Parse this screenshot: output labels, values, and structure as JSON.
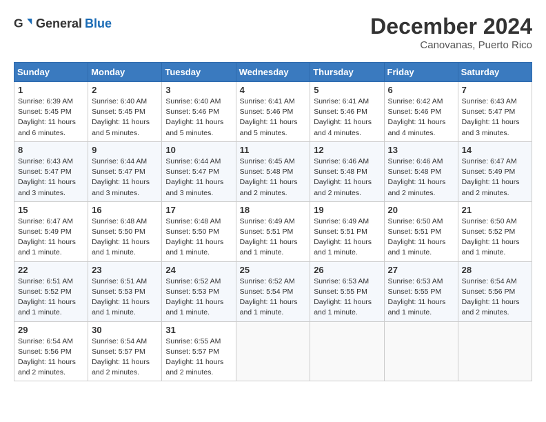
{
  "header": {
    "logo_general": "General",
    "logo_blue": "Blue",
    "month_year": "December 2024",
    "location": "Canovanas, Puerto Rico"
  },
  "weekdays": [
    "Sunday",
    "Monday",
    "Tuesday",
    "Wednesday",
    "Thursday",
    "Friday",
    "Saturday"
  ],
  "weeks": [
    [
      {
        "day": 1,
        "sunrise": "6:39 AM",
        "sunset": "5:45 PM",
        "daylight": "11 hours and 6 minutes."
      },
      {
        "day": 2,
        "sunrise": "6:40 AM",
        "sunset": "5:45 PM",
        "daylight": "11 hours and 5 minutes."
      },
      {
        "day": 3,
        "sunrise": "6:40 AM",
        "sunset": "5:46 PM",
        "daylight": "11 hours and 5 minutes."
      },
      {
        "day": 4,
        "sunrise": "6:41 AM",
        "sunset": "5:46 PM",
        "daylight": "11 hours and 5 minutes."
      },
      {
        "day": 5,
        "sunrise": "6:41 AM",
        "sunset": "5:46 PM",
        "daylight": "11 hours and 4 minutes."
      },
      {
        "day": 6,
        "sunrise": "6:42 AM",
        "sunset": "5:46 PM",
        "daylight": "11 hours and 4 minutes."
      },
      {
        "day": 7,
        "sunrise": "6:43 AM",
        "sunset": "5:47 PM",
        "daylight": "11 hours and 3 minutes."
      }
    ],
    [
      {
        "day": 8,
        "sunrise": "6:43 AM",
        "sunset": "5:47 PM",
        "daylight": "11 hours and 3 minutes."
      },
      {
        "day": 9,
        "sunrise": "6:44 AM",
        "sunset": "5:47 PM",
        "daylight": "11 hours and 3 minutes."
      },
      {
        "day": 10,
        "sunrise": "6:44 AM",
        "sunset": "5:47 PM",
        "daylight": "11 hours and 3 minutes."
      },
      {
        "day": 11,
        "sunrise": "6:45 AM",
        "sunset": "5:48 PM",
        "daylight": "11 hours and 2 minutes."
      },
      {
        "day": 12,
        "sunrise": "6:46 AM",
        "sunset": "5:48 PM",
        "daylight": "11 hours and 2 minutes."
      },
      {
        "day": 13,
        "sunrise": "6:46 AM",
        "sunset": "5:48 PM",
        "daylight": "11 hours and 2 minutes."
      },
      {
        "day": 14,
        "sunrise": "6:47 AM",
        "sunset": "5:49 PM",
        "daylight": "11 hours and 2 minutes."
      }
    ],
    [
      {
        "day": 15,
        "sunrise": "6:47 AM",
        "sunset": "5:49 PM",
        "daylight": "11 hours and 1 minute."
      },
      {
        "day": 16,
        "sunrise": "6:48 AM",
        "sunset": "5:50 PM",
        "daylight": "11 hours and 1 minute."
      },
      {
        "day": 17,
        "sunrise": "6:48 AM",
        "sunset": "5:50 PM",
        "daylight": "11 hours and 1 minute."
      },
      {
        "day": 18,
        "sunrise": "6:49 AM",
        "sunset": "5:51 PM",
        "daylight": "11 hours and 1 minute."
      },
      {
        "day": 19,
        "sunrise": "6:49 AM",
        "sunset": "5:51 PM",
        "daylight": "11 hours and 1 minute."
      },
      {
        "day": 20,
        "sunrise": "6:50 AM",
        "sunset": "5:51 PM",
        "daylight": "11 hours and 1 minute."
      },
      {
        "day": 21,
        "sunrise": "6:50 AM",
        "sunset": "5:52 PM",
        "daylight": "11 hours and 1 minute."
      }
    ],
    [
      {
        "day": 22,
        "sunrise": "6:51 AM",
        "sunset": "5:52 PM",
        "daylight": "11 hours and 1 minute."
      },
      {
        "day": 23,
        "sunrise": "6:51 AM",
        "sunset": "5:53 PM",
        "daylight": "11 hours and 1 minute."
      },
      {
        "day": 24,
        "sunrise": "6:52 AM",
        "sunset": "5:53 PM",
        "daylight": "11 hours and 1 minute."
      },
      {
        "day": 25,
        "sunrise": "6:52 AM",
        "sunset": "5:54 PM",
        "daylight": "11 hours and 1 minute."
      },
      {
        "day": 26,
        "sunrise": "6:53 AM",
        "sunset": "5:55 PM",
        "daylight": "11 hours and 1 minute."
      },
      {
        "day": 27,
        "sunrise": "6:53 AM",
        "sunset": "5:55 PM",
        "daylight": "11 hours and 1 minute."
      },
      {
        "day": 28,
        "sunrise": "6:54 AM",
        "sunset": "5:56 PM",
        "daylight": "11 hours and 2 minutes."
      }
    ],
    [
      {
        "day": 29,
        "sunrise": "6:54 AM",
        "sunset": "5:56 PM",
        "daylight": "11 hours and 2 minutes."
      },
      {
        "day": 30,
        "sunrise": "6:54 AM",
        "sunset": "5:57 PM",
        "daylight": "11 hours and 2 minutes."
      },
      {
        "day": 31,
        "sunrise": "6:55 AM",
        "sunset": "5:57 PM",
        "daylight": "11 hours and 2 minutes."
      },
      null,
      null,
      null,
      null
    ]
  ],
  "labels": {
    "sunrise_prefix": "Sunrise: ",
    "sunset_prefix": "Sunset: ",
    "daylight_prefix": "Daylight: "
  }
}
